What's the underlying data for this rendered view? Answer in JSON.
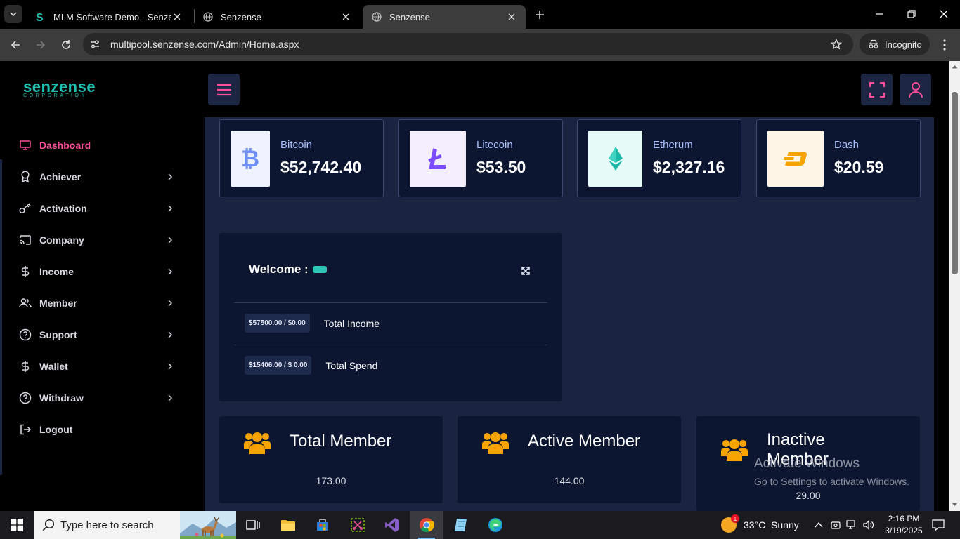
{
  "browser": {
    "tabs": [
      {
        "title": "MLM Software Demo - Senzense"
      },
      {
        "title": "Senzense"
      },
      {
        "title": "Senzense"
      }
    ],
    "url": "multipool.senzense.com/Admin/Home.aspx",
    "incognito_label": "Incognito"
  },
  "app": {
    "logo_main": "senzense",
    "logo_sub": "CORPORATION"
  },
  "sidebar": {
    "items": [
      {
        "label": "Dashboard",
        "icon": "monitor-icon",
        "active": true
      },
      {
        "label": "Achiever",
        "icon": "award-icon"
      },
      {
        "label": "Activation",
        "icon": "key-icon"
      },
      {
        "label": "Company",
        "icon": "cast-icon"
      },
      {
        "label": "Income",
        "icon": "dollar-icon"
      },
      {
        "label": "Member",
        "icon": "users-icon"
      },
      {
        "label": "Support",
        "icon": "help-circle-icon"
      },
      {
        "label": "Wallet",
        "icon": "dollar-icon"
      },
      {
        "label": "Withdraw",
        "icon": "help-circle-icon"
      },
      {
        "label": "Logout",
        "icon": "logout-icon"
      }
    ]
  },
  "coins": [
    {
      "name": "Bitcoin",
      "price": "$52,742.40",
      "color": "#6f8ff7",
      "bg": "#eef3ff"
    },
    {
      "name": "Litecoin",
      "price": "$53.50",
      "color": "#7b4dff",
      "bg": "#f3efff"
    },
    {
      "name": "Etherum",
      "price": "$2,327.16",
      "color": "#1bb8a8",
      "bg": "#e6fbf8"
    },
    {
      "name": "Dash",
      "price": "$20.59",
      "color": "#f7a400",
      "bg": "#fff6e8"
    }
  ],
  "welcome": {
    "title": "Welcome :",
    "rows": [
      {
        "value": "$57500.00 / $0.00",
        "label": "Total Income"
      },
      {
        "value": "$15406.00 / $ 0.00",
        "label": "Total Spend"
      }
    ]
  },
  "stats": [
    {
      "title": "Total Member",
      "value": "173.00"
    },
    {
      "title": "Active Member",
      "value": "144.00"
    },
    {
      "title": "Inactive Member",
      "value": "29.00"
    }
  ],
  "watermark": {
    "line1": "Activate Windows",
    "line2": "Go to Settings to activate Windows."
  },
  "taskbar": {
    "search_placeholder": "Type here to search",
    "weather": "33°C  Sunny",
    "time": "2:16 PM",
    "date": "3/19/2025",
    "weather_badge": "1"
  },
  "colors": {
    "accent_pink": "#ff4f9a",
    "teal": "#1ec0b0",
    "card_bg": "#0c1630",
    "content_bg": "#1a2440",
    "member_icon": "#f7a400"
  }
}
